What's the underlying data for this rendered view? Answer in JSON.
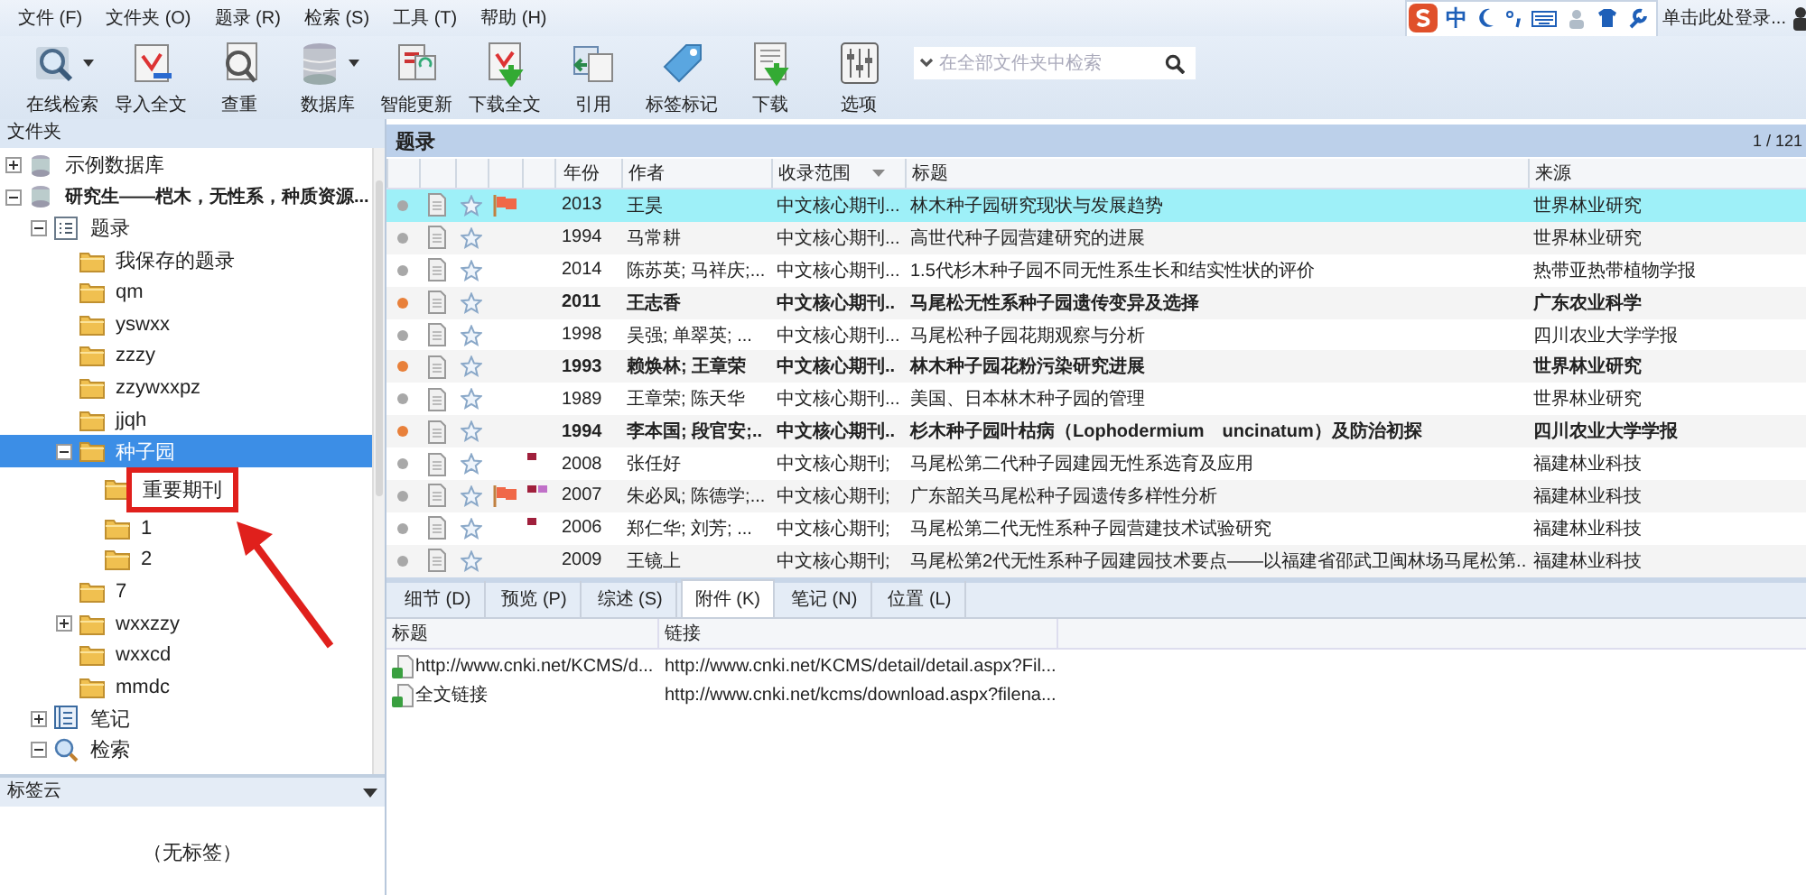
{
  "menu": [
    "文件 (F)",
    "文件夹 (O)",
    "题录 (R)",
    "检索 (S)",
    "工具 (T)",
    "帮助 (H)"
  ],
  "toolbar": {
    "buttons": [
      {
        "label": "在线检索",
        "dropdown": true
      },
      {
        "label": "导入全文",
        "dropdown": false
      },
      {
        "label": "查重",
        "dropdown": false
      },
      {
        "label": "数据库",
        "dropdown": true
      },
      {
        "label": "智能更新",
        "dropdown": false
      },
      {
        "label": "下载全文",
        "dropdown": false
      },
      {
        "label": "引用",
        "dropdown": false
      },
      {
        "label": "标签标记",
        "dropdown": false
      },
      {
        "label": "下载",
        "dropdown": false
      },
      {
        "label": "选项",
        "dropdown": false
      }
    ],
    "search": {
      "placeholder": "在全部文件夹中检索"
    }
  },
  "ime_bar": {
    "mode": "中"
  },
  "login": "单击此处登录...",
  "folder_pane": {
    "title": "文件夹",
    "tree": [
      {
        "label": "示例数据库",
        "kind": "database",
        "expanded": false,
        "selected": false
      },
      {
        "label": "研究生——桤木，无性系，种质资源...",
        "kind": "database",
        "expanded": true,
        "selected": false,
        "bold": true,
        "children": [
          {
            "label": "题录",
            "kind": "list",
            "expanded": true,
            "selected": false,
            "children": [
              {
                "label": "我保存的题录",
                "kind": "folder",
                "selected": false
              },
              {
                "label": "qm",
                "kind": "folder",
                "selected": false
              },
              {
                "label": "yswxx",
                "kind": "folder",
                "selected": false
              },
              {
                "label": "zzzy",
                "kind": "folder",
                "selected": false
              },
              {
                "label": "zzywxxpz",
                "kind": "folder",
                "selected": false
              },
              {
                "label": "jjqh",
                "kind": "folder",
                "selected": false
              },
              {
                "label": "种子园",
                "kind": "folder",
                "expanded": true,
                "selected": true,
                "children": [
                  {
                    "label": "重要期刊",
                    "kind": "folder",
                    "selected": false,
                    "annotated": true
                  },
                  {
                    "label": "1",
                    "kind": "folder",
                    "selected": false
                  },
                  {
                    "label": "2",
                    "kind": "folder",
                    "selected": false
                  }
                ]
              },
              {
                "label": "7",
                "kind": "folder",
                "selected": false
              },
              {
                "label": "wxxzzy",
                "kind": "folder",
                "expanded": false,
                "selected": false
              },
              {
                "label": "wxxcd",
                "kind": "folder",
                "selected": false
              },
              {
                "label": "mmdc",
                "kind": "folder",
                "selected": false
              }
            ]
          },
          {
            "label": "笔记",
            "kind": "notes",
            "expanded": false,
            "selected": false
          },
          {
            "label": "检索",
            "kind": "search",
            "expanded": true,
            "selected": false
          }
        ]
      }
    ]
  },
  "tag_cloud": {
    "title": "标签云",
    "empty_text": "（无标签）"
  },
  "list_pane": {
    "title": "题录",
    "page": "1 / 121",
    "columns": [
      {
        "label": "年份",
        "sorted": false
      },
      {
        "label": "作者",
        "sorted": false
      },
      {
        "label": "收录范围",
        "sorted": true
      },
      {
        "label": "标题",
        "sorted": false
      },
      {
        "label": "来源",
        "sorted": false
      }
    ],
    "rows": [
      {
        "selected": true,
        "unread": false,
        "flag": true,
        "tags": [],
        "year": "2013",
        "author": "王昊",
        "scope": "中文核心期刊...",
        "title": "林木种子园研究现状与发展趋势",
        "source": "世界林业研究"
      },
      {
        "selected": false,
        "unread": false,
        "flag": false,
        "tags": [],
        "year": "1994",
        "author": "马常耕",
        "scope": "中文核心期刊...",
        "title": "高世代种子园营建研究的进展",
        "source": "世界林业研究"
      },
      {
        "selected": false,
        "unread": false,
        "flag": false,
        "tags": [],
        "year": "2014",
        "author": "陈苏英; 马祥庆;...",
        "scope": "中文核心期刊...",
        "title": "1.5代杉木种子园不同无性系生长和结实性状的评价",
        "source": "热带亚热带植物学报"
      },
      {
        "selected": false,
        "unread": true,
        "flag": false,
        "tags": [],
        "year": "2011",
        "author": "王志香",
        "scope": "中文核心期刊..",
        "title": "马尾松无性系种子园遗传变异及选择",
        "source": "广东农业科学"
      },
      {
        "selected": false,
        "unread": false,
        "flag": false,
        "tags": [],
        "year": "1998",
        "author": "吴强; 单翠英; ...",
        "scope": "中文核心期刊...",
        "title": "马尾松种子园花期观察与分析",
        "source": "四川农业大学学报"
      },
      {
        "selected": false,
        "unread": true,
        "flag": false,
        "tags": [],
        "year": "1993",
        "author": "赖焕林; 王章荣",
        "scope": "中文核心期刊..",
        "title": "林木种子园花粉污染研究进展",
        "source": "世界林业研究"
      },
      {
        "selected": false,
        "unread": false,
        "flag": false,
        "tags": [],
        "year": "1989",
        "author": "王章荣; 陈天华",
        "scope": "中文核心期刊...",
        "title": "美国、日本林木种子园的管理",
        "source": "世界林业研究"
      },
      {
        "selected": false,
        "unread": true,
        "flag": false,
        "tags": [],
        "year": "1994",
        "author": "李本国; 段官安;..",
        "scope": "中文核心期刊..",
        "title": "杉木种子园叶枯病（Lophodermium　uncinatum）及防治初探",
        "source": "四川农业大学学报"
      },
      {
        "selected": false,
        "unread": false,
        "flag": false,
        "tags": [
          {
            "color": "#a0203c"
          }
        ],
        "year": "2008",
        "author": "张任好",
        "scope": "中文核心期刊;",
        "title": "马尾松第二代种子园建园无性系选育及应用",
        "source": "福建林业科技"
      },
      {
        "selected": false,
        "unread": false,
        "flag": true,
        "tags": [
          {
            "color": "#a0203c"
          },
          {
            "color": "#c070c8"
          }
        ],
        "year": "2007",
        "author": "朱必凤; 陈德学;...",
        "scope": "中文核心期刊;",
        "title": "广东韶关马尾松种子园遗传多样性分析",
        "source": "福建林业科技"
      },
      {
        "selected": false,
        "unread": false,
        "flag": false,
        "tags": [
          {
            "color": "#a0203c"
          }
        ],
        "year": "2006",
        "author": "郑仁华; 刘芳; ...",
        "scope": "中文核心期刊;",
        "title": "马尾松第二代无性系种子园营建技术试验研究",
        "source": "福建林业科技"
      },
      {
        "selected": false,
        "unread": false,
        "flag": false,
        "tags": [],
        "year": "2009",
        "author": "王镜上",
        "scope": "中文核心期刊;",
        "title": "马尾松第2代无性系种子园建园技术要点——以福建省邵武卫闽林场马尾松第...",
        "source": "福建林业科技"
      }
    ]
  },
  "detail": {
    "tabs": [
      {
        "label": "细节 (D)",
        "selected": false
      },
      {
        "label": "预览 (P)",
        "selected": false
      },
      {
        "label": "综述 (S)",
        "selected": false
      },
      {
        "label": "附件 (K)",
        "selected": true
      },
      {
        "label": "笔记 (N)",
        "selected": false
      },
      {
        "label": "位置 (L)",
        "selected": false
      }
    ],
    "columns": [
      "标题",
      "链接"
    ],
    "attachments": [
      {
        "title": "http://www.cnki.net/KCMS/d...",
        "link": "http://www.cnki.net/KCMS/detail/detail.aspx?Fil..."
      },
      {
        "title": "全文链接",
        "link": "http://www.cnki.net/kcms/download.aspx?filena..."
      }
    ]
  }
}
